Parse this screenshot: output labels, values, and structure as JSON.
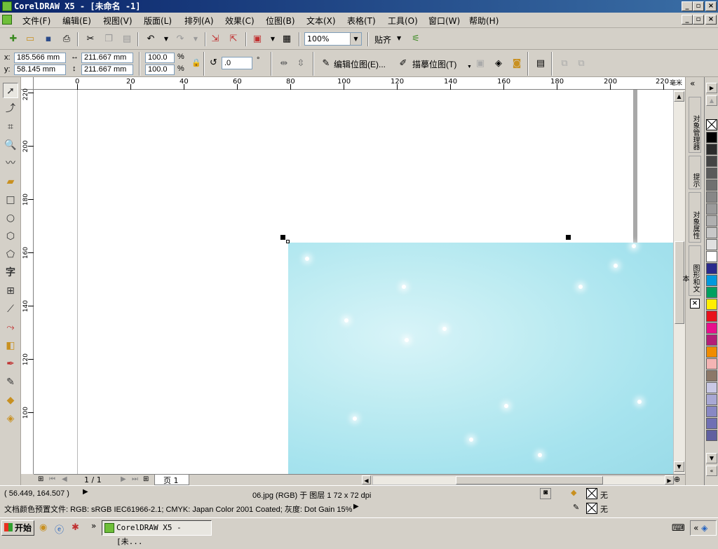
{
  "window": {
    "title": "CorelDRAW X5 - [未命名 -1]"
  },
  "menu": [
    "文件(F)",
    "编辑(E)",
    "视图(V)",
    "版面(L)",
    "排列(A)",
    "效果(C)",
    "位图(B)",
    "文本(X)",
    "表格(T)",
    "工具(O)",
    "窗口(W)",
    "帮助(H)"
  ],
  "toolbar": {
    "zoom": "100%",
    "snap_label": "贴齐"
  },
  "propbar": {
    "x_label": "x:",
    "x_value": "185.566 mm",
    "y_label": "y:",
    "y_value": "58.145 mm",
    "width_value": "211.667 mm",
    "height_value": "211.667 mm",
    "scale_w": "100.0",
    "scale_h": "100.0",
    "percent": "%",
    "rotation": ".0",
    "degree": "°",
    "edit_bitmap": "编辑位图(E)...",
    "trace_bitmap": "描摹位图(T)"
  },
  "ruler": {
    "unit": "毫米",
    "h_ticks": [
      "0",
      "20",
      "40",
      "60",
      "80",
      "100",
      "120",
      "140",
      "160",
      "180",
      "200",
      "220"
    ],
    "v_ticks": [
      "220",
      "200",
      "180",
      "160",
      "140",
      "120",
      "100"
    ]
  },
  "pagenav": {
    "page_count": "1 / 1",
    "page_tab": "页 1"
  },
  "dock": {
    "tabs": [
      "对象管理器",
      "提示",
      "对象属性",
      "图形和文本"
    ]
  },
  "palette": {
    "colors": [
      "#000000",
      "#2b2b2b",
      "#444444",
      "#5a5a5a",
      "#707070",
      "#878787",
      "#9b9b9b",
      "#b0b0b0",
      "#c8c8c8",
      "#e0e0e0",
      "#ffffff",
      "#2a2a8c",
      "#0099dd",
      "#00a060",
      "#ffee00",
      "#e8101c",
      "#e8108c",
      "#b41e78",
      "#f08c00",
      "#f4b4b4",
      "#8c7868",
      "#c8c8e4",
      "#a8a8d4",
      "#8888c4",
      "#7070b4",
      "#6060a0"
    ]
  },
  "status": {
    "coords": "( 56.449, 164.507 )",
    "object_info": "06.jpg (RGB) 于 图层 1 72 x 72 dpi",
    "fill_none": "无",
    "outline_none": "无",
    "color_profile": "文档颜色预置文件: RGB: sRGB IEC61966-2.1; CMYK: Japan Color 2001 Coated; 灰度: Dot Gain 15%"
  },
  "taskbar": {
    "start": "开始",
    "task": "CorelDRAW X5 - [未..."
  }
}
